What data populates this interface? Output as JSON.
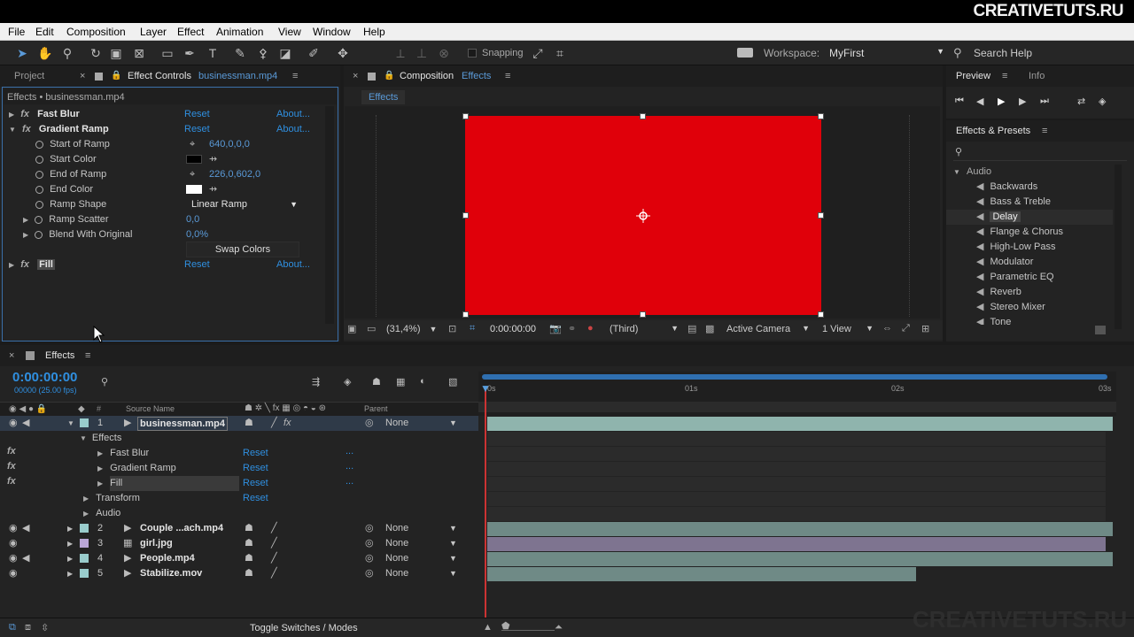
{
  "watermark_top": "CREATIVETUTS.RU",
  "watermark_bottom": "CREATIVETUTS.RU",
  "menu": [
    "File",
    "Edit",
    "Composition",
    "Layer",
    "Effect",
    "Animation",
    "View",
    "Window",
    "Help"
  ],
  "toolbar": {
    "snapping_label": "Snapping",
    "workspace_label": "Workspace:",
    "workspace_value": "MyFirst",
    "search_placeholder": "Search Help"
  },
  "project_panel": {
    "tab_label": "Project"
  },
  "effect_controls": {
    "tab_label": "Effect Controls",
    "tab_file": "businessman.mp4",
    "header": "Effects • businessman.mp4",
    "effects": [
      {
        "name": "Fast Blur",
        "reset": "Reset",
        "about": "About..."
      },
      {
        "name": "Gradient Ramp",
        "reset": "Reset",
        "about": "About..."
      },
      {
        "name": "Fill",
        "reset": "Reset",
        "about": "About..."
      }
    ],
    "params": {
      "start_of_ramp": {
        "label": "Start of Ramp",
        "value": "640,0,0,0"
      },
      "start_color": {
        "label": "Start Color",
        "color": "#000000"
      },
      "end_of_ramp": {
        "label": "End of Ramp",
        "value": "226,0,602,0"
      },
      "end_color": {
        "label": "End Color",
        "color": "#ffffff"
      },
      "ramp_shape": {
        "label": "Ramp Shape",
        "value": "Linear Ramp"
      },
      "ramp_scatter": {
        "label": "Ramp Scatter",
        "value": "0,0"
      },
      "blend_with_original": {
        "label": "Blend With Original",
        "value": "0,0%"
      }
    },
    "swap_colors": "Swap Colors"
  },
  "composition": {
    "tab_label": "Composition",
    "tab_name": "Effects",
    "chip": "Effects",
    "fill_color": "#e0000a",
    "zoom": "(31,4%)",
    "timecode": "0:00:00:00",
    "resolution": "(Third)",
    "camera": "Active Camera",
    "view": "1 View"
  },
  "preview": {
    "tab_label": "Preview",
    "info_label": "Info"
  },
  "effects_presets": {
    "tab_label": "Effects & Presets",
    "search_placeholder": "",
    "category": "Audio",
    "items": [
      "Backwards",
      "Bass & Treble",
      "Delay",
      "Flange & Chorus",
      "High-Low Pass",
      "Modulator",
      "Parametric EQ",
      "Reverb",
      "Stereo Mixer",
      "Tone"
    ],
    "selected": "Delay"
  },
  "timeline": {
    "tab_label": "Effects",
    "timecode": "0:00:00:00",
    "fps": "00000 (25.00 fps)",
    "col_hash": "#",
    "col_source": "Source Name",
    "col_parent": "Parent",
    "ruler": [
      "0s",
      "01s",
      "02s",
      "03s"
    ],
    "layers": [
      {
        "num": "1",
        "name": "businessman.mp4",
        "parent": "None"
      },
      {
        "num": "2",
        "name": "Couple ...ach.mp4",
        "parent": "None"
      },
      {
        "num": "3",
        "name": "girl.jpg",
        "parent": "None"
      },
      {
        "num": "4",
        "name": "People.mp4",
        "parent": "None"
      },
      {
        "num": "5",
        "name": "Stabilize.mov",
        "parent": "None"
      }
    ],
    "sub": {
      "effects": "Effects",
      "fast_blur": "Fast Blur",
      "gradient_ramp": "Gradient Ramp",
      "fill": "Fill",
      "transform": "Transform",
      "audio": "Audio",
      "reset": "Reset",
      "dots": "..."
    },
    "toggle_label": "Toggle Switches / Modes"
  }
}
